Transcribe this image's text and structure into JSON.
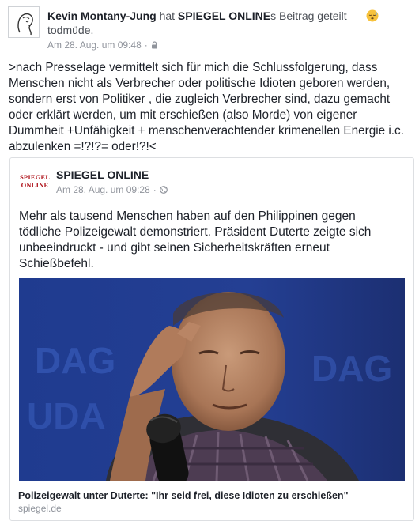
{
  "post": {
    "author": "Kevin Montany-Jung",
    "verb": "hat",
    "shared_page": "SPIEGEL ONLINE",
    "shared_suffix": "s Beitrag geteilt —",
    "feeling": "todmüde.",
    "timestamp": "Am 28. Aug. um 09:48",
    "privacy_icon": "lock-icon",
    "feeling_icon": "sleepy-face-emoji",
    "text": ">nach Presselage vermittelt sich für mich die Schlussfolgerung, dass Menschen nicht als Verbrecher oder politische Idioten geboren werden, sondern erst von Politiker , die zugleich Verbrecher sind, dazu gemacht oder erklärt werden, um mit erschießen (also Morde) von eigener Dummheit +Unfähigkeit + menschenverachtender krimenellen Energie i.c.  abzulenken =!?!?= oder!?!<"
  },
  "shared": {
    "logo_line1": "SPIEGEL",
    "logo_line2": "ONLINE",
    "page_name": "SPIEGEL ONLINE",
    "timestamp": "Am 28. Aug. um 09:28",
    "privacy_icon": "globe-icon",
    "text": "Mehr als tausend Menschen haben auf den Philippinen gegen tödliche Polizeigewalt demonstriert. Präsident Duterte zeigte sich unbeeindruckt - und gibt seinen Sicherheitskräften erneut Schießbefehl.",
    "link_title": "Polizeigewalt unter Duterte: \"Ihr seid frei, diese Idioten zu erschießen\"",
    "link_domain": "spiegel.de"
  },
  "colors": {
    "logo_red": "#b0151d",
    "meta_gray": "#90949c",
    "text": "#1d2129",
    "image_backdrop": "#1a2a6a"
  }
}
